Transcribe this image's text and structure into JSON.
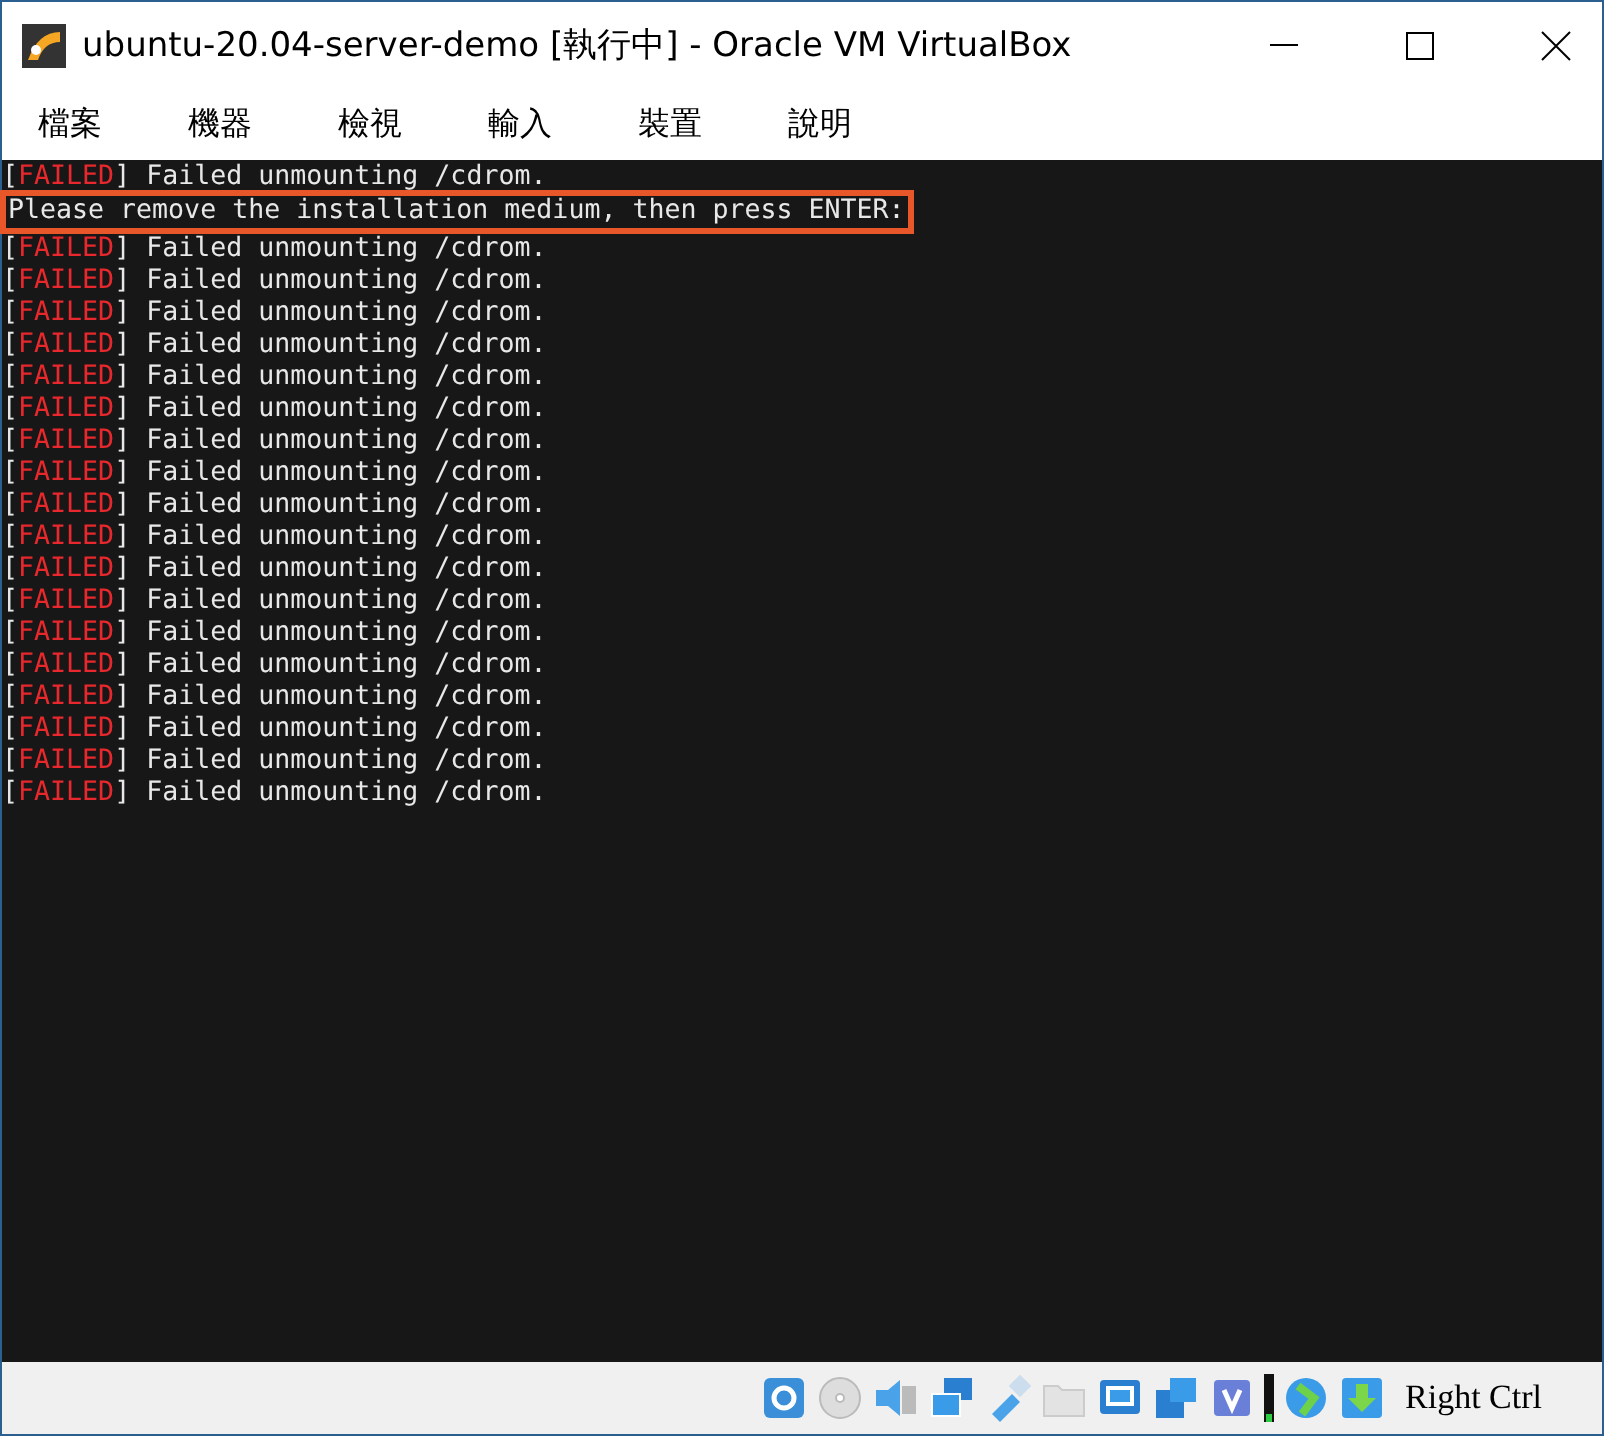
{
  "window": {
    "title": "ubuntu-20.04-server-demo [執行中] - Oracle VM VirtualBox"
  },
  "menu": [
    {
      "label": "檔案"
    },
    {
      "label": "機器"
    },
    {
      "label": "檢視"
    },
    {
      "label": "輸入"
    },
    {
      "label": "裝置"
    },
    {
      "label": "說明"
    }
  ],
  "console": {
    "lines": [
      {
        "kind": "status",
        "open": "[",
        "status": "FAILED",
        "close": "]",
        "message": "Failed unmounting /cdrom."
      },
      {
        "kind": "prompt",
        "text": "Please remove the installation medium, then press ENTER:",
        "highlighted": true
      },
      {
        "kind": "status",
        "open": "[",
        "status": "FAILED",
        "close": "]",
        "message": "Failed unmounting /cdrom."
      },
      {
        "kind": "status",
        "open": "[",
        "status": "FAILED",
        "close": "]",
        "message": "Failed unmounting /cdrom."
      },
      {
        "kind": "status",
        "open": "[",
        "status": "FAILED",
        "close": "]",
        "message": "Failed unmounting /cdrom."
      },
      {
        "kind": "status",
        "open": "[",
        "status": "FAILED",
        "close": "]",
        "message": "Failed unmounting /cdrom."
      },
      {
        "kind": "status",
        "open": "[",
        "status": "FAILED",
        "close": "]",
        "message": "Failed unmounting /cdrom."
      },
      {
        "kind": "status",
        "open": "[",
        "status": "FAILED",
        "close": "]",
        "message": "Failed unmounting /cdrom."
      },
      {
        "kind": "status",
        "open": "[",
        "status": "FAILED",
        "close": "]",
        "message": "Failed unmounting /cdrom."
      },
      {
        "kind": "status",
        "open": "[",
        "status": "FAILED",
        "close": "]",
        "message": "Failed unmounting /cdrom."
      },
      {
        "kind": "status",
        "open": "[",
        "status": "FAILED",
        "close": "]",
        "message": "Failed unmounting /cdrom."
      },
      {
        "kind": "status",
        "open": "[",
        "status": "FAILED",
        "close": "]",
        "message": "Failed unmounting /cdrom."
      },
      {
        "kind": "status",
        "open": "[",
        "status": "FAILED",
        "close": "]",
        "message": "Failed unmounting /cdrom."
      },
      {
        "kind": "status",
        "open": "[",
        "status": "FAILED",
        "close": "]",
        "message": "Failed unmounting /cdrom."
      },
      {
        "kind": "status",
        "open": "[",
        "status": "FAILED",
        "close": "]",
        "message": "Failed unmounting /cdrom."
      },
      {
        "kind": "status",
        "open": "[",
        "status": "FAILED",
        "close": "]",
        "message": "Failed unmounting /cdrom."
      },
      {
        "kind": "status",
        "open": "[",
        "status": "FAILED",
        "close": "]",
        "message": "Failed unmounting /cdrom."
      },
      {
        "kind": "status",
        "open": "[",
        "status": "FAILED",
        "close": "]",
        "message": "Failed unmounting /cdrom."
      },
      {
        "kind": "status",
        "open": "[",
        "status": "FAILED",
        "close": "]",
        "message": "Failed unmounting /cdrom."
      },
      {
        "kind": "status",
        "open": "[",
        "status": "FAILED",
        "close": "]",
        "message": "Failed unmounting /cdrom."
      }
    ]
  },
  "status_bar": {
    "host_key": "Right Ctrl"
  }
}
